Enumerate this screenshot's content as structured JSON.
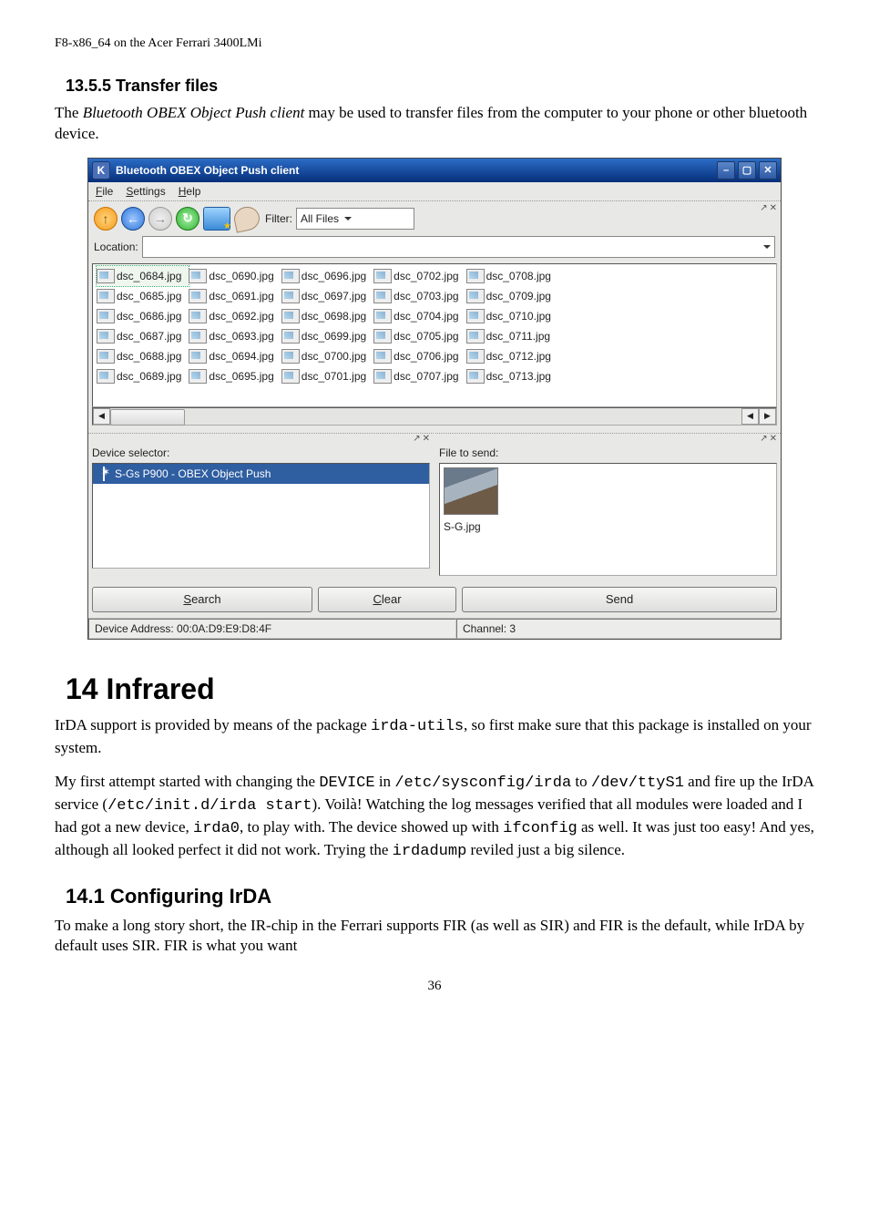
{
  "doc": {
    "header": "F8-x86_64 on the Acer Ferrari 3400LMi",
    "section_1355": "13.5.5 Transfer files",
    "p_transfer_pre": "The ",
    "p_transfer_em": "Bluetooth OBEX Object Push client",
    "p_transfer_post": " may be used to transfer files from the computer to your phone or other bluetooth device.",
    "section_14": "14 Infrared",
    "p_infrared_1a": "IrDA support is provided by means of the package ",
    "p_infrared_1b": "irda-utils",
    "p_infrared_1c": ", so first make sure that this package is installed on your system.",
    "p_infrared_2a": "My first attempt started with changing the ",
    "p_infrared_2b": "DEVICE",
    "p_infrared_2c": " in ",
    "p_infrared_2d": "/etc/sysconfig/irda",
    "p_infrared_2e": " to ",
    "p_infrared_2f": "/dev/ttyS1",
    "p_infrared_2g": " and fire up the IrDA service (",
    "p_infrared_2h": "/etc/init.d/irda start",
    "p_infrared_2i": "). Voilà! Watching the log messages verified that all modules were loaded and I had got a new device, ",
    "p_infrared_2j": "irda0",
    "p_infrared_2k": ", to play with. The device showed up with ",
    "p_infrared_2l": "ifconfig",
    "p_infrared_2m": " as well. It was just too easy! And yes, although all looked perfect it did not work. Trying the ",
    "p_infrared_2n": "irdadump",
    "p_infrared_2o": " reviled just a big silence.",
    "section_141": "14.1 Configuring IrDA",
    "p_141": "To make a long story short, the IR-chip in the Ferrari supports FIR (as well as SIR) and FIR is the default, while IrDA by default uses SIR. FIR is what you want",
    "page_number": "36"
  },
  "app": {
    "title_icon": "K",
    "title": "Bluetooth OBEX Object Push client",
    "menus": {
      "file_u": "F",
      "file_rest": "ile",
      "settings_u": "S",
      "settings_rest": "ettings",
      "help_u": "H",
      "help_rest": "elp"
    },
    "filter_label": "Filter:",
    "filter_value": "All Files",
    "location_label": "Location:",
    "location_value": "",
    "pane_detach": "↗",
    "pane_close": "✕",
    "files": {
      "col1": [
        "dsc_0684.jpg",
        "dsc_0685.jpg",
        "dsc_0686.jpg",
        "dsc_0687.jpg",
        "dsc_0688.jpg",
        "dsc_0689.jpg"
      ],
      "col2": [
        "dsc_0690.jpg",
        "dsc_0691.jpg",
        "dsc_0692.jpg",
        "dsc_0693.jpg",
        "dsc_0694.jpg",
        "dsc_0695.jpg"
      ],
      "col3": [
        "dsc_0696.jpg",
        "dsc_0697.jpg",
        "dsc_0698.jpg",
        "dsc_0699.jpg",
        "dsc_0700.jpg",
        "dsc_0701.jpg"
      ],
      "col4": [
        "dsc_0702.jpg",
        "dsc_0703.jpg",
        "dsc_0704.jpg",
        "dsc_0705.jpg",
        "dsc_0706.jpg",
        "dsc_0707.jpg"
      ],
      "col5": [
        "dsc_0708.jpg",
        "dsc_0709.jpg",
        "dsc_0710.jpg",
        "dsc_0711.jpg",
        "dsc_0712.jpg",
        "dsc_0713.jpg"
      ]
    },
    "selected_file_index": 0,
    "device_selector_label": "Device selector:",
    "device_row": "S-Gs P900 - OBEX Object Push",
    "file_to_send_label": "File to send:",
    "preview_name": "S-G.jpg",
    "buttons": {
      "search_u": "S",
      "search_rest": "earch",
      "clear_u": "C",
      "clear_rest": "lear",
      "send": "Send"
    },
    "status_addr": "Device Address: 00:0A:D9:E9:D8:4F",
    "status_channel": "Channel: 3",
    "scroll": {
      "left": "◀",
      "right": "▶"
    },
    "win": {
      "min": "–",
      "max": "▢",
      "close": "✕"
    }
  }
}
